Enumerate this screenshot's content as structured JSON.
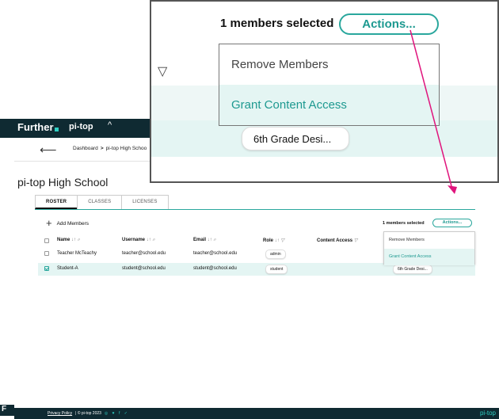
{
  "header": {
    "brand": "Further",
    "product": "pi-top",
    "caret": "^"
  },
  "breadcrumb": {
    "root": "Dashboard",
    "separator": ">",
    "current": "pi-top High Schoo"
  },
  "page": {
    "title": "pi-top High School"
  },
  "tabs": [
    {
      "label": "ROSTER"
    },
    {
      "label": "CLASSES"
    },
    {
      "label": "LICENSES"
    }
  ],
  "toolbar": {
    "add_label": "Add Members",
    "selected_text": "1 members selected",
    "actions_label": "Actions..."
  },
  "table": {
    "columns": [
      "Name",
      "Username",
      "Email",
      "Role",
      "Content Access"
    ],
    "sort_glyph": "↓↑ ⌕",
    "rows": [
      {
        "name": "Teacher McTeachy",
        "username": "teacher@school.edu",
        "email": "teacher@school.edu",
        "role": "admin",
        "content": "",
        "checked": false
      },
      {
        "name": "Student-A",
        "username": "student@school.edu",
        "email": "student@school.edu",
        "role": "student",
        "content": "6th Grade Desi...",
        "checked": true
      }
    ]
  },
  "actions_menu": {
    "items": [
      {
        "label": "Remove Members"
      },
      {
        "label": "Grant Content Access"
      }
    ]
  },
  "zoom": {
    "selected_text": "1 members selected",
    "actions_label": "Actions...",
    "items": [
      "Remove Members",
      "Grant Content Access"
    ],
    "grade_pill": "6th Grade Desi..."
  },
  "footer": {
    "privacy": "Privacy Policy",
    "copyright": "| © pi-top 2023",
    "social": "◎ ♥ f ✓",
    "brand": "pi-top",
    "mark": "F"
  },
  "colors": {
    "accent": "#2aa79d",
    "dark": "#0f2a32",
    "highlight": "#e4f5f3",
    "arrow": "#e0157d"
  }
}
